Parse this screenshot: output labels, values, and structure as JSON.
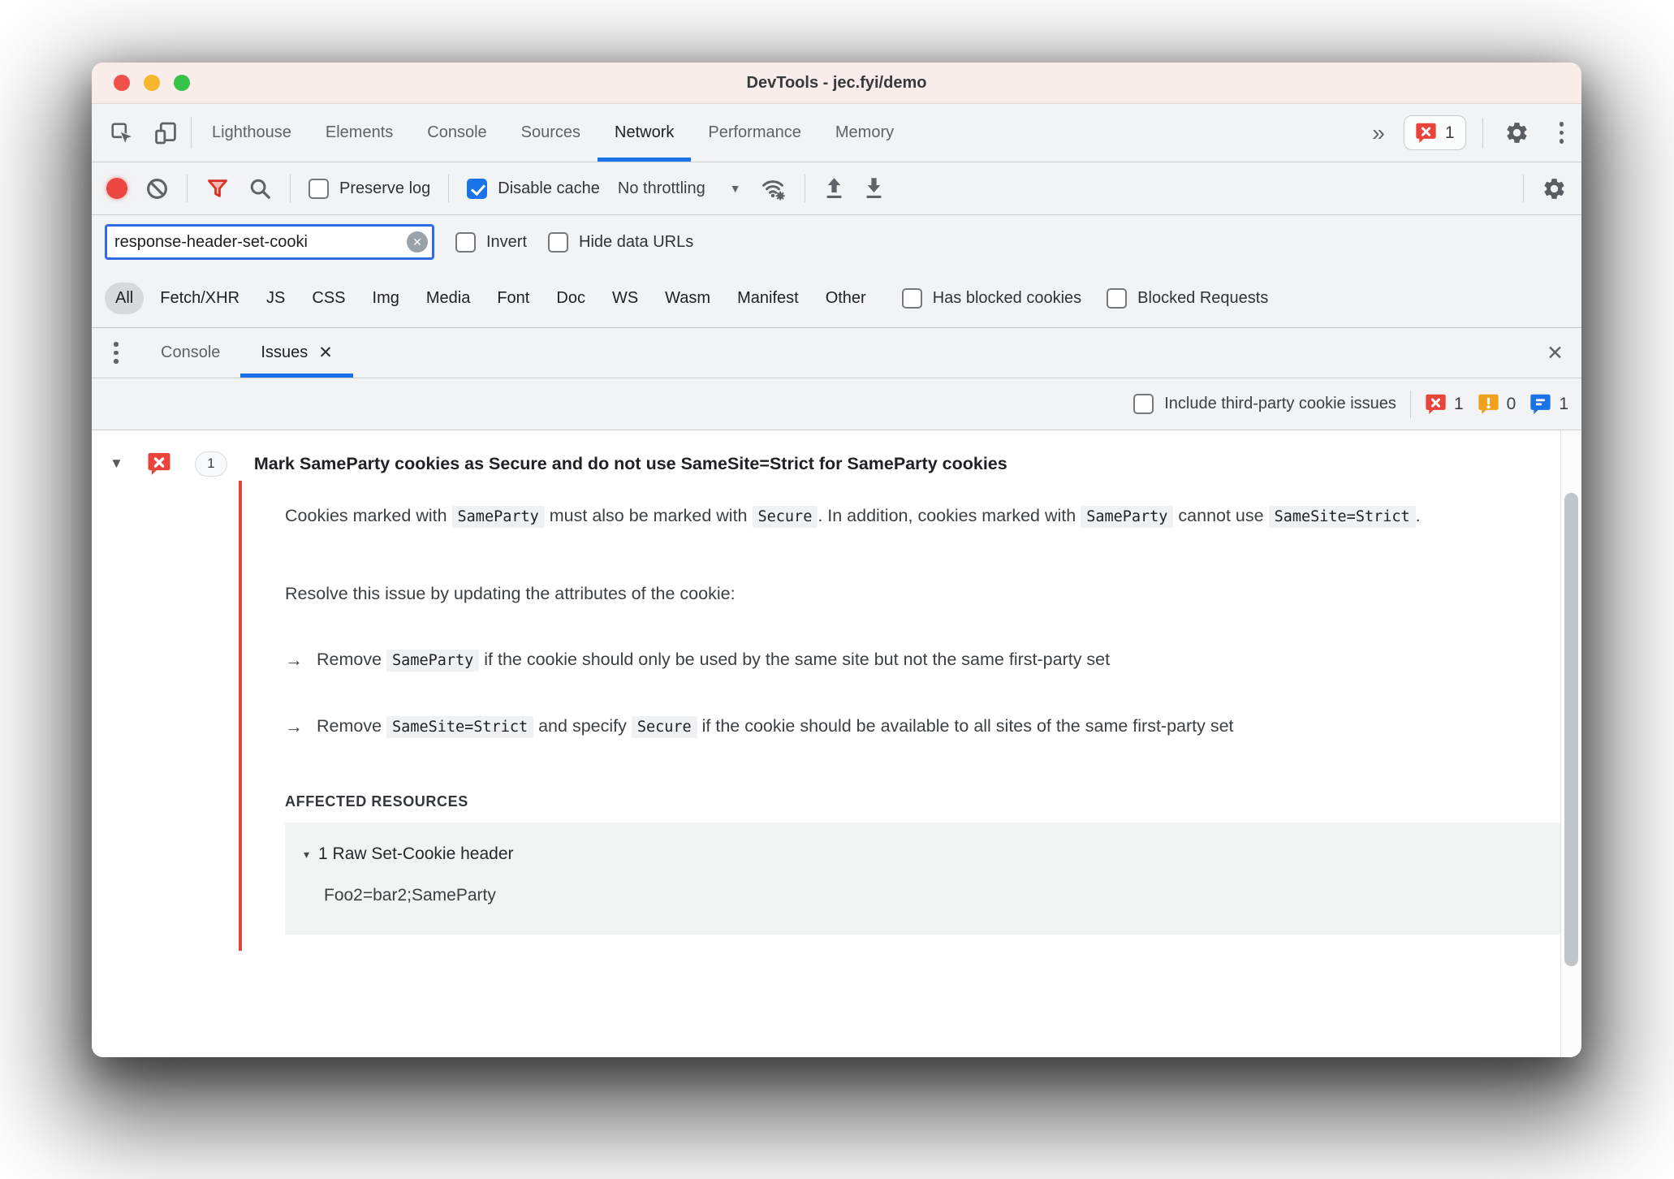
{
  "window": {
    "title": "DevTools - jec.fyi/demo"
  },
  "tabs": {
    "items": [
      "Lighthouse",
      "Elements",
      "Console",
      "Sources",
      "Network",
      "Performance",
      "Memory"
    ],
    "active": "Network",
    "overflow": "»",
    "error_count": "1"
  },
  "net_toolbar": {
    "preserve_log": "Preserve log",
    "disable_cache": "Disable cache",
    "throttling": "No throttling",
    "caret": "▼"
  },
  "filter": {
    "value": "response-header-set-cooki",
    "clear_glyph": "✕",
    "invert": "Invert",
    "hide_data_urls": "Hide data URLs"
  },
  "type_filters": {
    "items": [
      "All",
      "Fetch/XHR",
      "JS",
      "CSS",
      "Img",
      "Media",
      "Font",
      "Doc",
      "WS",
      "Wasm",
      "Manifest",
      "Other"
    ],
    "selected": "All",
    "has_blocked_cookies": "Has blocked cookies",
    "blocked_requests": "Blocked Requests"
  },
  "drawer": {
    "console_tab": "Console",
    "issues_tab": "Issues",
    "tab_close": "✕",
    "drawer_close": "✕"
  },
  "issues_bar": {
    "include_label": "Include third-party cookie issues",
    "error_count": "1",
    "warning_count": "0",
    "info_count": "1"
  },
  "issue": {
    "expander": "▼",
    "count": "1",
    "title": "Mark SameParty cookies as Secure and do not use SameSite=Strict for SameParty cookies",
    "description": [
      {
        "v": "Cookies marked with "
      },
      {
        "c": 1,
        "v": "SameParty"
      },
      {
        "v": " must also be marked with "
      },
      {
        "c": 1,
        "v": "Secure"
      },
      {
        "v": ". In addition, cookies marked with "
      },
      {
        "c": 1,
        "v": "SameParty"
      },
      {
        "v": " cannot use "
      },
      {
        "c": 1,
        "v": "SameSite=Strict"
      },
      {
        "v": "."
      }
    ],
    "resolve": "Resolve this issue by updating the attributes of the cookie:",
    "bullet_marker": "→",
    "bullets": [
      [
        {
          "v": "Remove "
        },
        {
          "c": 1,
          "v": "SameParty"
        },
        {
          "v": " if the cookie should only be used by the same site but not the same first-party set"
        }
      ],
      [
        {
          "v": "Remove "
        },
        {
          "c": 1,
          "v": "SameSite=Strict"
        },
        {
          "v": " and specify "
        },
        {
          "c": 1,
          "v": "Secure"
        },
        {
          "v": " if the cookie should be available to all sites of the same first-party set"
        }
      ]
    ],
    "affected_heading": "AFFECTED RESOURCES",
    "resource_expander": "▾",
    "resource_group": "1 Raw Set-Cookie header",
    "resource_value": "Foo2=bar2;SameParty"
  },
  "colors": {
    "accent_blue": "#1a73e8",
    "error_red": "#e9443b",
    "warning_orange": "#f0a11c"
  }
}
